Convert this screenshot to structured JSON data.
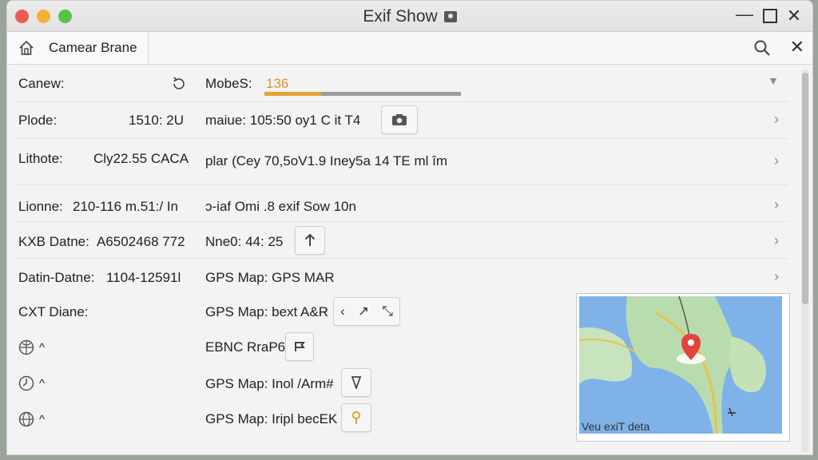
{
  "window": {
    "title": "Exif Show",
    "minimize_glyph": "—",
    "close_glyph": "✕"
  },
  "toolbar": {
    "tab_label": "Camear Brane",
    "close_glyph": "✕"
  },
  "left": {
    "rows": [
      {
        "label": "Canew:",
        "value": ""
      },
      {
        "label": "Plode:",
        "value": "1510: 2U"
      },
      {
        "label": "Lithote:",
        "value": "Cly22.55 CACA"
      },
      {
        "label": "Lionne:",
        "value": "210-116 m.51:/ In"
      },
      {
        "label": "KXB Datne:",
        "value": "A6502468 772"
      },
      {
        "label": "Datin-Datne:",
        "value": "1104-12591l"
      },
      {
        "label": "CXT Diane:",
        "value": ""
      }
    ],
    "caret_glyph": "^"
  },
  "right": {
    "row1": {
      "label": "MobeS:",
      "value": "136"
    },
    "row2": {
      "text": "maiue: 105:50 oy1 C it T4"
    },
    "row3": {
      "text": "plar (Cey 70,5oV1.9 Iney5a 14 TE ml îm"
    },
    "row4": {
      "text": "ɔ-iaf Omi .8 exif Sow 10n"
    },
    "row5": {
      "text": "Nne0: 44: 25"
    },
    "row6": {
      "text": "GPS Map: GPS MAR"
    },
    "row7": {
      "text": "GPS Map: bext A&R"
    },
    "row8": {
      "text": "EBNC RraP6"
    },
    "row9": {
      "text": "GPS Map: Inol /Arm#"
    },
    "row10": {
      "text": "GPS Map: Iripl becEK"
    },
    "row7_buttons": [
      "‹",
      "↗",
      "⤡"
    ]
  },
  "progress": {
    "value": 0.29
  },
  "map": {
    "caption": "Veu exiT deta"
  },
  "colors": {
    "accent": "#e2a43a",
    "pin": "#e0453a",
    "water": "#7fb2e8",
    "land": "#b9dcae"
  },
  "icons": [
    "home-icon",
    "search-icon",
    "refresh-icon",
    "camera-icon",
    "arrow-up-icon",
    "flag-icon",
    "pin-icon",
    "globe-icon",
    "map-pin-icon"
  ]
}
